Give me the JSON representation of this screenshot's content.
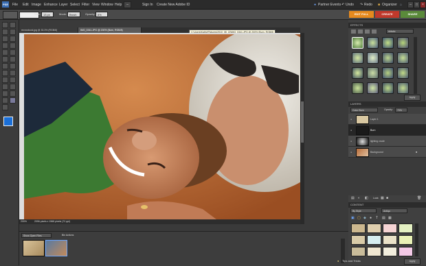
{
  "menu": {
    "logo": "PSE",
    "items": [
      "File",
      "Edit",
      "Image",
      "Enhance",
      "Layer",
      "Select",
      "Filter",
      "View",
      "Window",
      "Help"
    ],
    "sign_in": "Sign In",
    "create_id": "Create New Adobe ID",
    "right_items": [
      "Partner Events",
      "Undo",
      "Redo",
      "Organizer"
    ]
  },
  "options": {
    "size_label": "Size:",
    "size_value": "13 px",
    "mode_label": "Mode:",
    "mode_value": "Brush",
    "opacity_label": "Opacity:",
    "opacity_value": "8%"
  },
  "mode_tabs": {
    "edit": "EDIT FULL",
    "create": "CREATE",
    "share": "SHARE"
  },
  "colors": {
    "edit_tab": "#e68a1e",
    "create_tab": "#c0392b",
    "share_tab": "#5a8a3a",
    "accent": "#3b6fb6"
  },
  "document": {
    "tabs": [
      "recrosbook.jpg @ 33.3% (RGB/8)",
      "IMG_0341.JPG @ 200% (Burn, RGB/8)"
    ],
    "tooltip": "C:\\Users\\Kathy\\Pictures\\2010_08_22\\IMG_0341.JPG @ 200% (Burn, RGB/8)",
    "zoom": "200%",
    "doc_info": "2096 pixels x 1568 pixels (72 ppi)"
  },
  "bin": {
    "dropdown": "Show Open Files",
    "bin_actions": "Bin Actions"
  },
  "effects_panel": {
    "title": "EFFECTS",
    "filter_value": "Artistic",
    "apply": "Apply"
  },
  "layers_panel": {
    "title": "LAYERS",
    "blend_mode": "Color Burn",
    "opacity_label": "Opacity:",
    "opacity_value": "70%",
    "lock_label": "Lock:",
    "layers": [
      {
        "name": "Layer 1",
        "selected": false
      },
      {
        "name": "Burn",
        "selected": true
      },
      {
        "name": "lighting crude",
        "selected": false
      },
      {
        "name": "Background",
        "selected": false
      }
    ]
  },
  "content_panel": {
    "title": "CONTENT",
    "sort_value": "By Style",
    "filter_value": "Antiqu",
    "apply": "Apply"
  },
  "taskbar": {
    "tips": "Tips and Tricks"
  }
}
